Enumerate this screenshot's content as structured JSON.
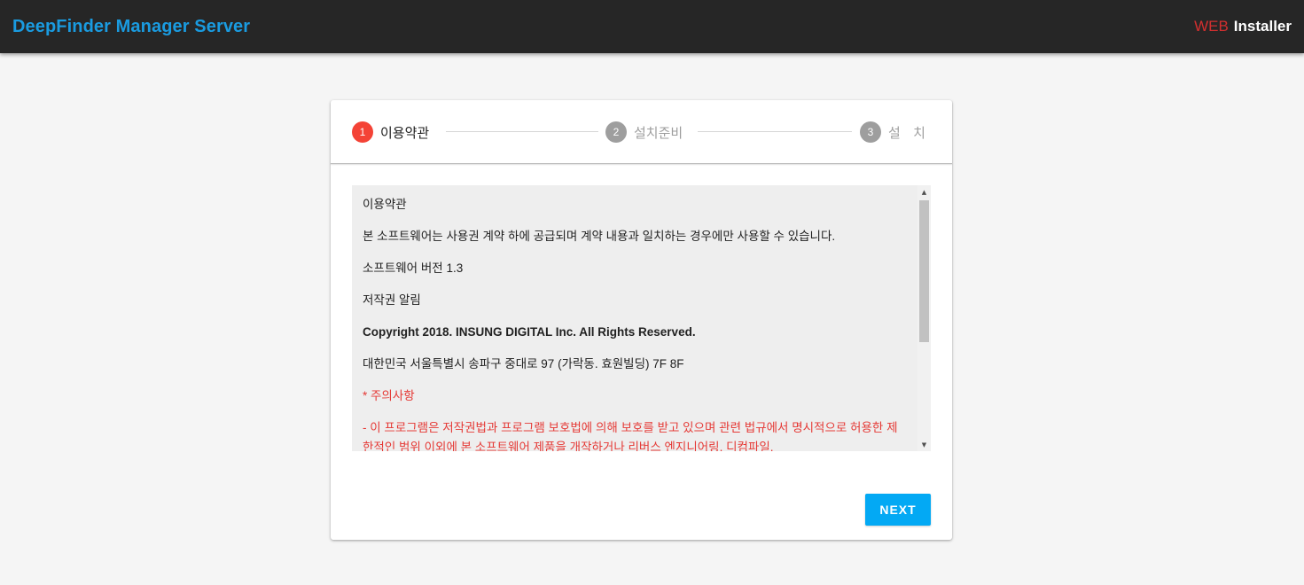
{
  "header": {
    "title": "DeepFinder Manager Server",
    "brand_web": "WEB",
    "brand_installer": "Installer"
  },
  "stepper": {
    "steps": [
      {
        "number": "1",
        "label": "이용약관",
        "state": "active"
      },
      {
        "number": "2",
        "label": "설치준비",
        "state": "inactive"
      },
      {
        "number": "3",
        "label": "설   치",
        "state": "inactive"
      }
    ]
  },
  "terms": {
    "lines": [
      "이용약관",
      "본 소프트웨어는 사용권 계약 하에 공급되며 계약 내용과 일치하는 경우에만 사용할 수 있습니다.",
      "소프트웨어 버전 1.3",
      "저작권 알림",
      "Copyright 2018. INSUNG DIGITAL Inc. All Rights Reserved.",
      "대한민국 서울특별시 송파구 중대로 97 (가락동. 효원빌딩) 7F 8F",
      "* 주의사항",
      "- 이 프로그램은 저작권법과 프로그램 보호법에 의해 보호를 받고 있으며 관련 법규에서 명시적으로 허용한 제한적인 범위 이외에 본 소프트웨어 제품을 개작하거나 리버스 엔지니어링, 디컴파일,"
    ]
  },
  "actions": {
    "next_label": "NEXT"
  },
  "colors": {
    "topbar_bg": "#262626",
    "title": "#1a9be0",
    "brand_web": "#d32f2f",
    "active_step": "#f44336",
    "inactive_step": "#9e9e9e",
    "primary_button": "#03a9f4",
    "warning_text": "#e53935"
  }
}
